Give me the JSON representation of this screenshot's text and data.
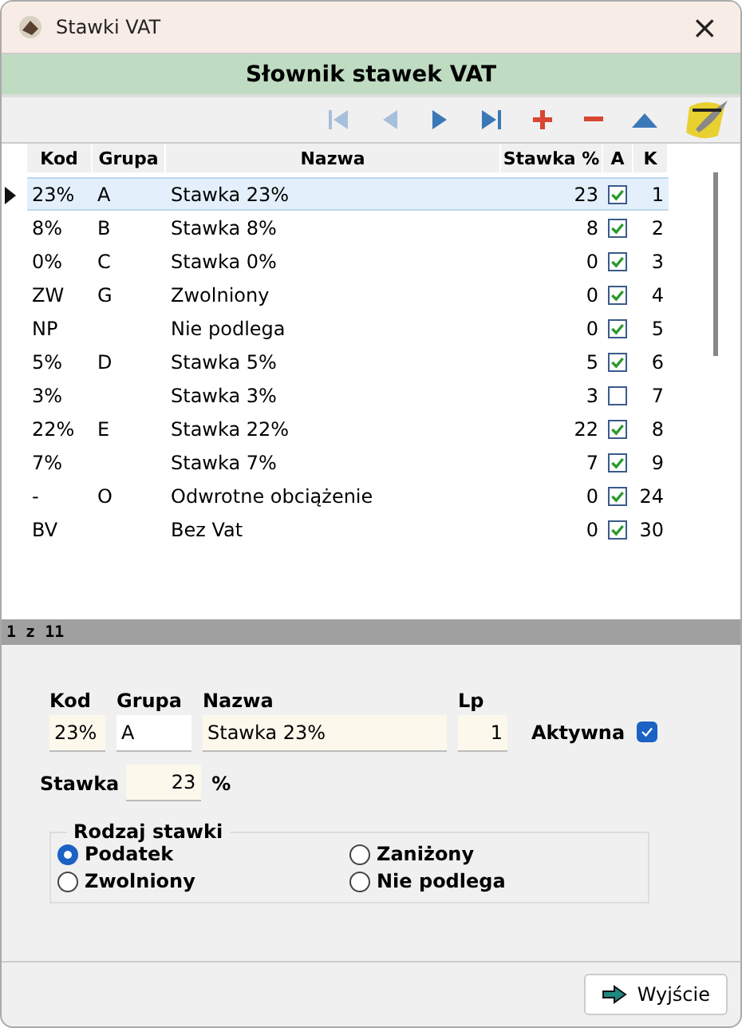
{
  "window": {
    "title": "Stawki VAT",
    "close": "×"
  },
  "header": {
    "title": "Słownik stawek VAT"
  },
  "toolbar": [
    {
      "kind": "first",
      "disabled": true
    },
    {
      "kind": "prev",
      "disabled": true
    },
    {
      "kind": "next",
      "disabled": false
    },
    {
      "kind": "last",
      "disabled": false
    },
    {
      "kind": "add",
      "disabled": false
    },
    {
      "kind": "delete",
      "disabled": false
    },
    {
      "kind": "up",
      "disabled": false
    }
  ],
  "table": {
    "columns": [
      "Kod",
      "Grupa",
      "Nazwa",
      "Stawka %",
      "A",
      "K"
    ],
    "rows": [
      {
        "kod": "23%",
        "grupa": "A",
        "nazwa": "Stawka 23%",
        "stawka": "23",
        "active": true,
        "k": "1",
        "selected": true
      },
      {
        "kod": "8%",
        "grupa": "B",
        "nazwa": "Stawka 8%",
        "stawka": "8",
        "active": true,
        "k": "2",
        "selected": false
      },
      {
        "kod": "0%",
        "grupa": "C",
        "nazwa": "Stawka 0%",
        "stawka": "0",
        "active": true,
        "k": "3",
        "selected": false
      },
      {
        "kod": "ZW",
        "grupa": "G",
        "nazwa": "Zwolniony",
        "stawka": "0",
        "active": true,
        "k": "4",
        "selected": false
      },
      {
        "kod": "NP",
        "grupa": "",
        "nazwa": "Nie podlega",
        "stawka": "0",
        "active": true,
        "k": "5",
        "selected": false
      },
      {
        "kod": "5%",
        "grupa": "D",
        "nazwa": "Stawka 5%",
        "stawka": "5",
        "active": true,
        "k": "6",
        "selected": false
      },
      {
        "kod": "3%",
        "grupa": "",
        "nazwa": "Stawka 3%",
        "stawka": "3",
        "active": false,
        "k": "7",
        "selected": false
      },
      {
        "kod": "22%",
        "grupa": "E",
        "nazwa": "Stawka 22%",
        "stawka": "22",
        "active": true,
        "k": "8",
        "selected": false
      },
      {
        "kod": "7%",
        "grupa": "",
        "nazwa": "Stawka 7%",
        "stawka": "7",
        "active": true,
        "k": "9",
        "selected": false
      },
      {
        "kod": "-",
        "grupa": "O",
        "nazwa": "Odwrotne obciążenie",
        "stawka": "0",
        "active": true,
        "k": "24",
        "selected": false
      },
      {
        "kod": "BV",
        "grupa": "",
        "nazwa": "Bez Vat",
        "stawka": "0",
        "active": true,
        "k": "30",
        "selected": false
      }
    ]
  },
  "status": "1 z 11",
  "form": {
    "kod": {
      "label": "Kod",
      "value": "23%"
    },
    "grupa": {
      "label": "Grupa",
      "value": "A"
    },
    "nazwa": {
      "label": "Nazwa",
      "value": "Stawka 23%"
    },
    "lp": {
      "label": "Lp",
      "value": "1"
    },
    "aktywna": {
      "label": "Aktywna",
      "checked": true
    },
    "stawka": {
      "label": "Stawka",
      "value": "23",
      "unit": "%"
    },
    "rodzaj": {
      "title": "Rodzaj stawki",
      "options": [
        {
          "label": "Podatek",
          "selected": true
        },
        {
          "label": "Zaniżony",
          "selected": false
        },
        {
          "label": "Zwolniony",
          "selected": false
        },
        {
          "label": "Nie podlega",
          "selected": false
        }
      ]
    }
  },
  "footer": {
    "button": "Wyjście"
  }
}
